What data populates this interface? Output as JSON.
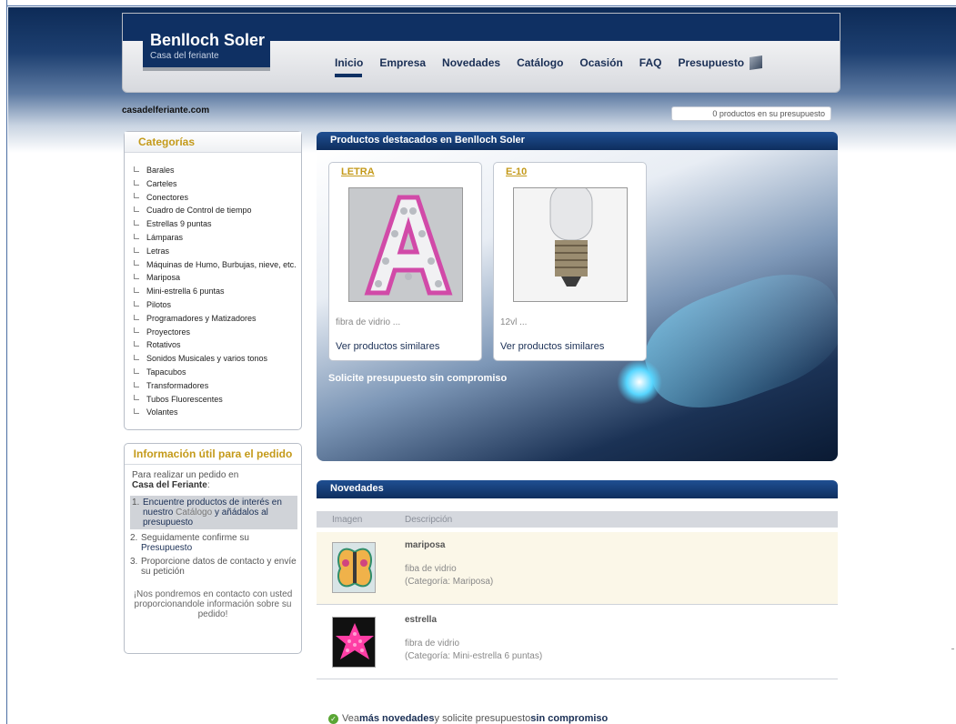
{
  "header": {
    "logo_name": "Benlloch Soler",
    "logo_sub": "Casa del feriante",
    "nav": [
      "Inicio",
      "Empresa",
      "Novedades",
      "Catálogo",
      "Ocasión",
      "FAQ",
      "Presupuesto"
    ]
  },
  "domain": "casadelferiante.com",
  "cart": "0 productos en su presupuesto",
  "categories": {
    "title": "Categorías",
    "items": [
      "Barales",
      "Carteles",
      "Conectores",
      "Cuadro de Control de tiempo",
      "Estrellas 9 puntas",
      "Lámparas",
      "Letras",
      "Máquinas de Humo, Burbujas, nieve, etc.",
      "Mariposa",
      "Mini-estrella 6 puntas",
      "Pilotos",
      "Programadores y Matizadores",
      "Proyectores",
      "Rotativos",
      "Sonidos Musicales y varios tonos",
      "Tapacubos",
      "Transformadores",
      "Tubos Fluorescentes",
      "Volantes"
    ]
  },
  "info": {
    "title": "Información útil para el pedido",
    "intro": "Para realizar un pedido en",
    "intro_bold": "Casa del Feriante",
    "intro_end": ":",
    "step1_a": "Encuentre productos de interés en nuestro ",
    "step1_b": "Catálogo",
    "step1_c": " y añádalos al presupuesto",
    "step2_a": "Seguidamente confirme su ",
    "step2_b": "Presupuesto",
    "step3": "Proporcione datos de contacto y envíe su petición",
    "footer": "¡Nos pondremos en contacto con usted proporcionandole información sobre su pedido!"
  },
  "featured": {
    "title": "Productos destacados en Benlloch Soler",
    "cards": [
      {
        "name": "LETRA",
        "desc": "fibra de vidrio ...",
        "link": "Ver productos similares"
      },
      {
        "name": "E-10",
        "desc": "12vl ...",
        "link": "Ver productos similares"
      }
    ],
    "cta": "Solicite presupuesto sin compromiso"
  },
  "novedades": {
    "title": "Novedades",
    "col_image": "Imagen",
    "col_desc": "Descripción",
    "rows": [
      {
        "title": "mariposa",
        "desc": "fiba de vidrio",
        "cat": "(Categoría: Mariposa)"
      },
      {
        "title": "estrella",
        "desc": "fibra de vidrio",
        "cat": "(Categoría: Mini-estrella 6 puntas)"
      }
    ]
  },
  "bottom": {
    "a": "Vea ",
    "b": "más novedades",
    "c": " y solicite presupuesto ",
    "d": "sin compromiso"
  }
}
